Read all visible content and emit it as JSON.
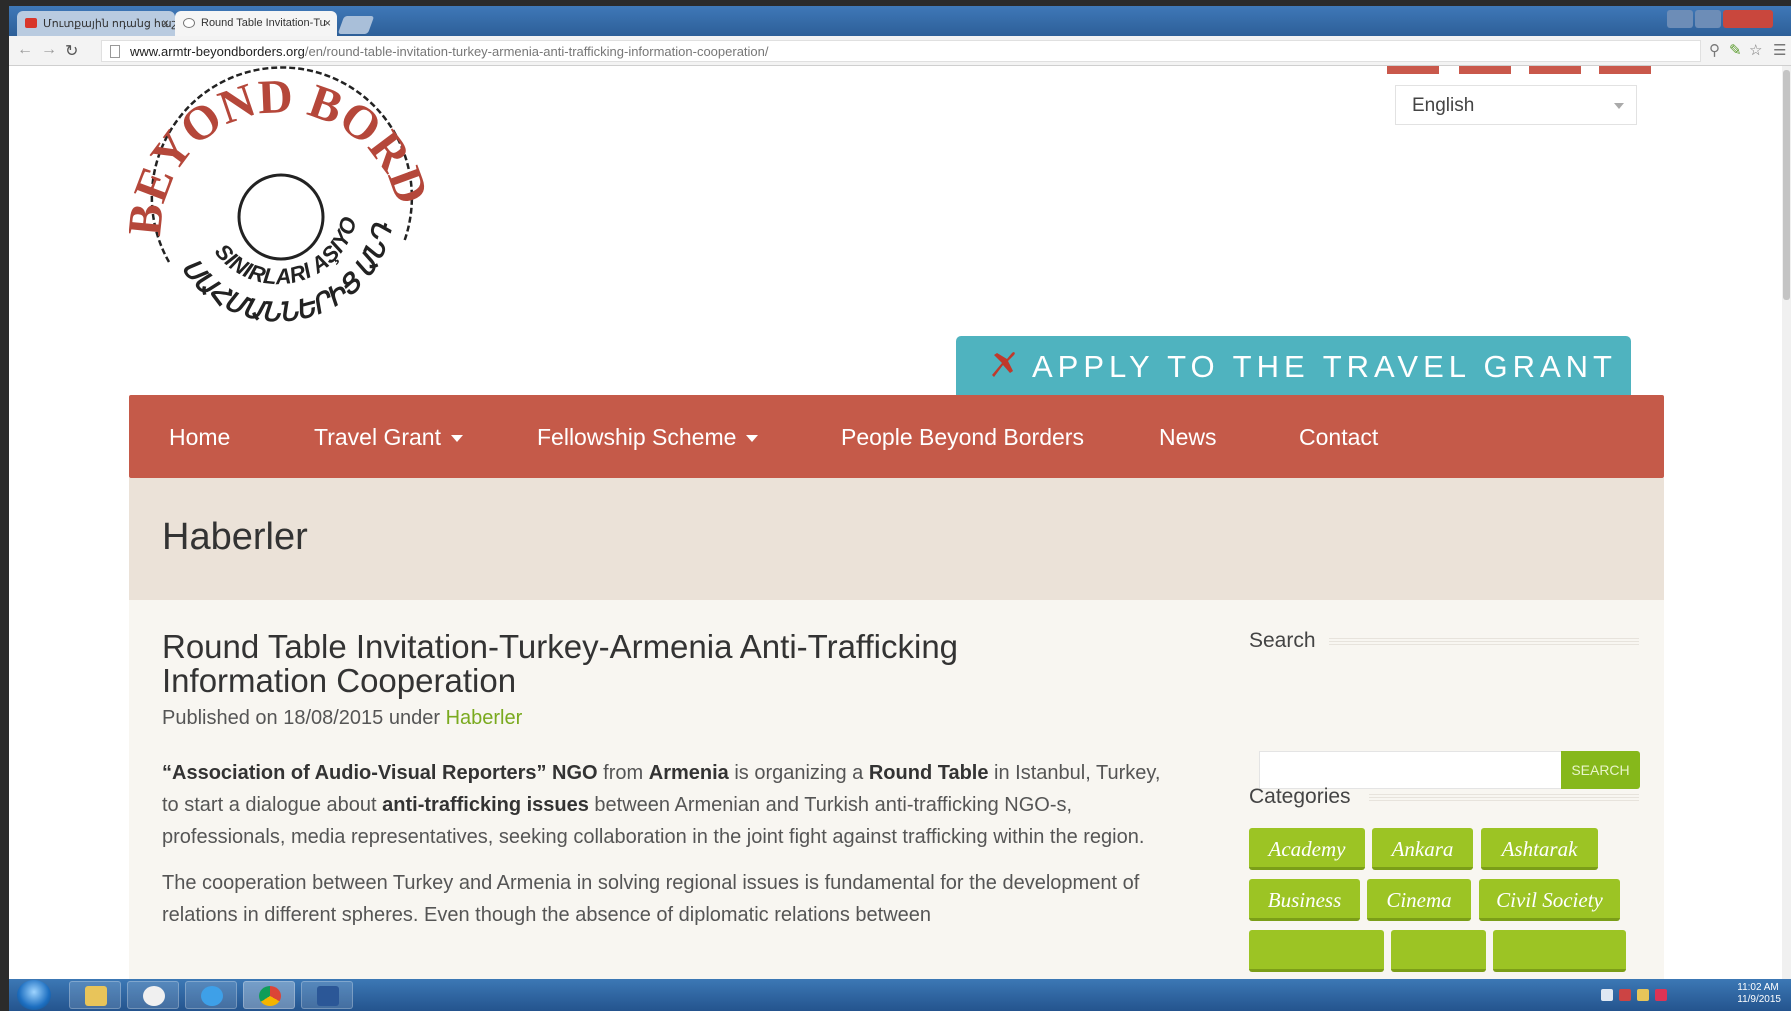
{
  "browser": {
    "tabs": [
      {
        "label": "Մուտքային ոդանց հաշվ...",
        "active": false
      },
      {
        "label": "Round Table Invitation-Tu",
        "active": true
      }
    ],
    "url_domain": "www.armtr-beyondborders.org",
    "url_path": "/en/round-table-invitation-turkey-armenia-anti-trafficking-information-cooperation/"
  },
  "site": {
    "language": "English",
    "logo": {
      "top_text": "BEYOND BORDERS",
      "middle_text": "SINIRLARI AŞIYORUZ",
      "bottom_text": "ՍԱՀՄԱՆՆԵՐԻՑ ԱՆԴ"
    },
    "apply_banner": "APPLY TO THE TRAVEL GRANT",
    "nav": [
      {
        "label": "Home",
        "dropdown": false
      },
      {
        "label": "Travel Grant",
        "dropdown": true
      },
      {
        "label": "Fellowship Scheme",
        "dropdown": true
      },
      {
        "label": "People Beyond Borders",
        "dropdown": false
      },
      {
        "label": "News",
        "dropdown": false
      },
      {
        "label": "Contact",
        "dropdown": false
      }
    ],
    "page_heading": "Haberler"
  },
  "post": {
    "title": "Round Table Invitation-Turkey-Armenia Anti-Trafficking Information Cooperation",
    "meta_prefix": "Published on 18/08/2015 under",
    "meta_category": "Haberler",
    "p1": {
      "s1": "“Association of Audio-Visual Reporters” NGO",
      "s2": " from ",
      "s3": "Armenia",
      "s4": " is organizing a ",
      "s5": "Round Table",
      "s6": " in Istanbul, Turkey, to start a dialogue about ",
      "s7": "anti-trafficking issues",
      "s8": " between Armenian and Turkish anti-trafficking NGO-s, professionals, media representatives, seeking collaboration in the joint fight against trafficking within the region."
    },
    "p2": "The cooperation between Turkey and Armenia in solving regional issues is fundamental for the development of relations in different spheres. Even though the absence of diplomatic relations between"
  },
  "sidebar": {
    "search_heading": "Search",
    "search_value": "",
    "search_button": "SEARCH",
    "categories_heading": "Categories",
    "categories": [
      "Academy",
      "Ankara",
      "Ashtarak",
      "Business",
      "Cinema",
      "Civil Society"
    ]
  },
  "taskbar": {
    "time": "11:02 AM",
    "date": "11/9/2015"
  }
}
